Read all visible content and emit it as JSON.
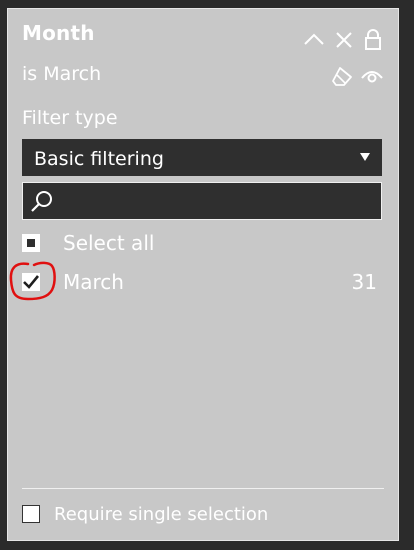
{
  "filter_card": {
    "title": "Month",
    "subtitle": "is March",
    "header_icons": [
      "collapse-chevron-up-icon",
      "close-icon",
      "lock-icon",
      "eraser-icon",
      "eye-icon"
    ],
    "filter_type_label": "Filter type",
    "filter_type_value": "Basic filtering",
    "search_placeholder": "",
    "items": [
      {
        "label": "Select all",
        "state": "partial",
        "count": ""
      },
      {
        "label": "March",
        "state": "checked",
        "count": "31"
      }
    ],
    "require_single_selection_label": "Require single selection",
    "require_single_selection_checked": false
  },
  "colors": {
    "background": "#2b2b2b",
    "card": "#c8c8c8",
    "input_background": "#2f2f2f",
    "text": "#ffffff",
    "annotation": "#e01010"
  }
}
